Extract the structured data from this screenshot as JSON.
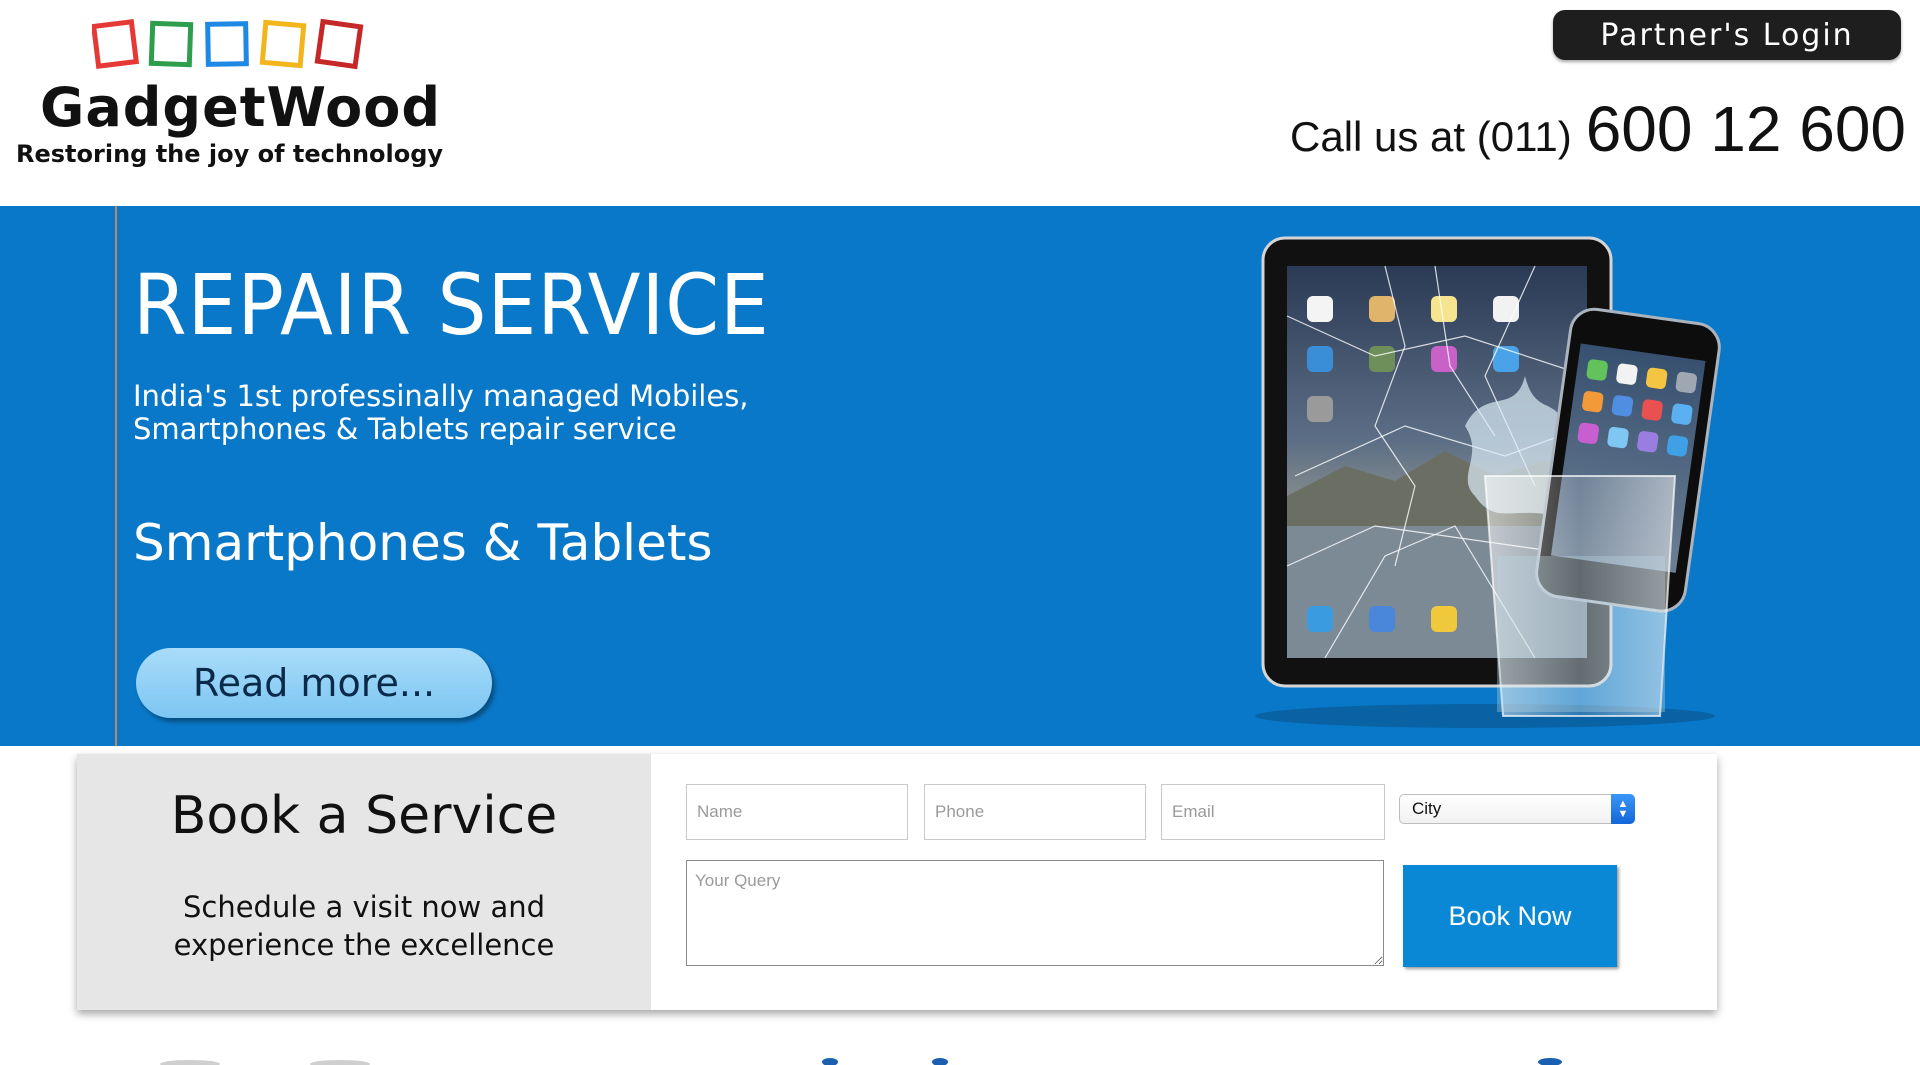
{
  "header": {
    "logo_title": "GadgetWood",
    "logo_tagline": "Restoring the joy of technology",
    "logo_square_colors": [
      "#e53935",
      "#2e9e4c",
      "#1e88e5",
      "#f2b51b",
      "#c62828"
    ],
    "partner_login_label": "Partner's Login",
    "call_label": "Call us at (011)",
    "call_number": "600 12 600"
  },
  "hero": {
    "title": "REPAIR SERVICE",
    "description_line1": "India's 1st professinally managed Mobiles,",
    "description_line2": "Smartphones & Tablets repair service",
    "subtitle": "Smartphones & Tablets",
    "read_more_label": "Read more...",
    "background_color": "#0a78c8",
    "image_icon": "broken-tablet-and-phone-image"
  },
  "booking": {
    "title": "Book a Service",
    "subtitle_line1": "Schedule a visit now and",
    "subtitle_line2": "experience the excellence",
    "name_placeholder": "Name",
    "phone_placeholder": "Phone",
    "email_placeholder": "Email",
    "city_selected": "City",
    "query_placeholder": "Your Query",
    "book_now_label": "Book Now"
  }
}
